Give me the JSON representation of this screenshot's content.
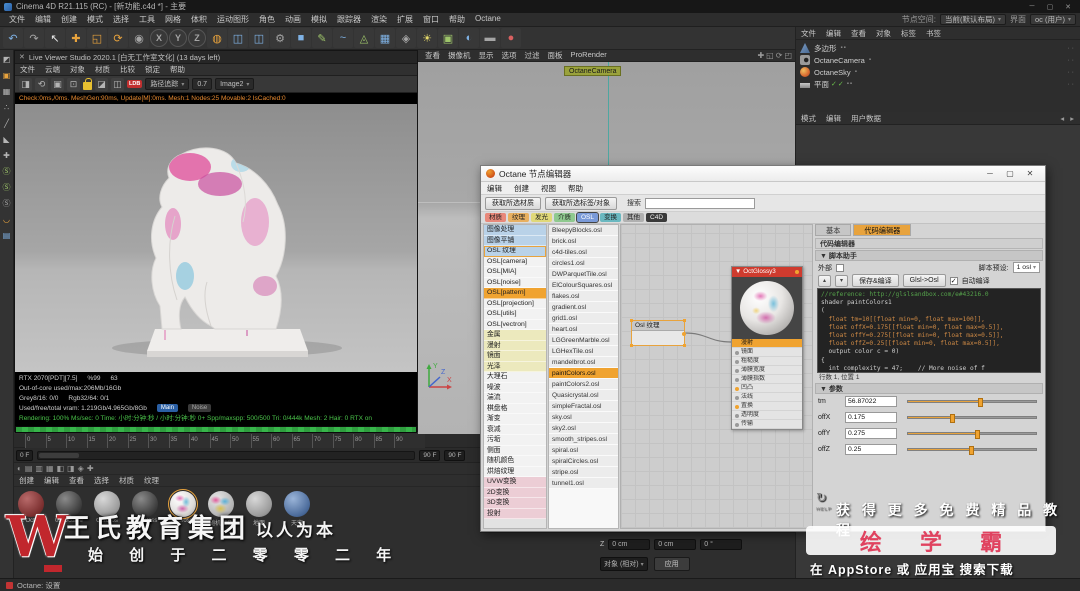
{
  "window": {
    "title": "Cinema 4D R21.115 (RC) - [新功能.c4d *] - 主要",
    "controls": {
      "min": "─",
      "max": "▢",
      "close": "✕"
    },
    "menus": [
      "文件",
      "编辑",
      "创建",
      "模式",
      "选择",
      "工具",
      "网格",
      "体积",
      "运动图形",
      "角色",
      "动画",
      "模拟",
      "跟踪器",
      "渲染",
      "扩展",
      "窗口",
      "帮助",
      "Octane"
    ],
    "node_space_label": "节点空间:",
    "node_space_value": "当前(默认布局)",
    "interface_label": "界面",
    "interface_value": "oc (用户)"
  },
  "toolbar": {
    "icons": [
      {
        "g": "↶",
        "cls": "c-blue",
        "name": "undo-icon"
      },
      {
        "g": "↷",
        "cls": "c-dim",
        "name": "redo-icon"
      },
      {
        "g": "↖",
        "cls": "c-white",
        "name": "selection-tool-icon"
      },
      {
        "g": "✚",
        "cls": "c-orange",
        "name": "move-tool-icon"
      },
      {
        "g": "◱",
        "cls": "c-orange",
        "name": "scale-tool-icon"
      },
      {
        "g": "⟳",
        "cls": "c-orange",
        "name": "rotate-tool-icon"
      },
      {
        "g": "◉",
        "cls": "c-dim",
        "name": "last-tool-icon"
      },
      {
        "g": "X",
        "cls": "c-dim tb-letter",
        "name": "x-axis-lock-icon"
      },
      {
        "g": "Y",
        "cls": "c-dim tb-letter",
        "name": "y-axis-lock-icon"
      },
      {
        "g": "Z",
        "cls": "c-dim tb-letter",
        "name": "z-axis-lock-icon"
      },
      {
        "g": "◍",
        "cls": "c-orange",
        "name": "coordinate-system-icon"
      },
      {
        "g": "◫",
        "cls": "c-blue",
        "name": "render-view-icon"
      },
      {
        "g": "◫",
        "cls": "c-blue",
        "name": "render-picture-viewer-icon"
      },
      {
        "g": "⚙",
        "cls": "c-dim",
        "name": "render-settings-icon"
      },
      {
        "g": "■",
        "cls": "c-blue",
        "name": "add-cube-icon"
      },
      {
        "g": "✎",
        "cls": "c-green",
        "name": "pen-tool-icon"
      },
      {
        "g": "~",
        "cls": "c-blue",
        "name": "spline-icon"
      },
      {
        "g": "◬",
        "cls": "c-green",
        "name": "mograph-icon"
      },
      {
        "g": "▦",
        "cls": "c-blue",
        "name": "volume-icon"
      },
      {
        "g": "◈",
        "cls": "c-dim",
        "name": "simulation-icon"
      },
      {
        "g": "☀",
        "cls": "c-yellow",
        "name": "light-icon"
      },
      {
        "g": "▣",
        "cls": "c-green",
        "name": "camera-icon"
      },
      {
        "g": "◐",
        "cls": "c-blue",
        "name": "environment-icon"
      },
      {
        "g": "▬",
        "cls": "c-dim",
        "name": "floor-icon"
      },
      {
        "g": "●",
        "cls": "c-red",
        "name": "material-ball-icon"
      }
    ]
  },
  "left_tools": [
    {
      "g": "◩",
      "cls": "c-gray",
      "name": "make-editable-icon"
    },
    {
      "g": "▣",
      "cls": "c-orange",
      "name": "model-mode-icon"
    },
    {
      "g": "▦",
      "cls": "c-gray",
      "name": "texture-mode-icon"
    },
    {
      "g": "∴",
      "cls": "c-gray",
      "name": "points-mode-icon"
    },
    {
      "g": "╱",
      "cls": "c-gray",
      "name": "edges-mode-icon"
    },
    {
      "g": "◣",
      "cls": "c-gray",
      "name": "polygons-mode-icon"
    },
    {
      "g": "✚",
      "cls": "c-gray",
      "name": "enable-axis-icon"
    },
    {
      "g": "Ⓢ",
      "cls": "c-green",
      "name": "viewport-solo-off-icon"
    },
    {
      "g": "Ⓢ",
      "cls": "c-green",
      "name": "viewport-solo-single-icon"
    },
    {
      "g": "Ⓢ",
      "cls": "c-dim",
      "name": "viewport-solo-hierarchy-icon"
    },
    {
      "g": "◡",
      "cls": "c-orange",
      "name": "snap-icon"
    },
    {
      "g": "▤",
      "cls": "c-blue",
      "name": "workplane-icon"
    }
  ],
  "live_viewer": {
    "close": "✕",
    "title": "Live Viewer Studio 2020.1 [白无工作室文化] (13 days left)",
    "menus": [
      "文件",
      "云端",
      "对象",
      "材质",
      "比较",
      "锁定",
      "帮助"
    ],
    "icons": [
      {
        "g": "◨",
        "name": "panel-toggle-icon"
      },
      {
        "g": "⟲",
        "name": "restart-render-icon"
      },
      {
        "g": "▣",
        "name": "focus-render-icon"
      },
      {
        "g": "⊡",
        "name": "region-render-icon"
      }
    ],
    "badge": "LDB",
    "kernel_value": "路径追踪",
    "exposure_value": "0.7",
    "image_value": "Image2",
    "info": "Check:0ms,/0ms. MeshGen:90ms, Update[M]:0ms. Mesh:1 Nodes:25 Movable:2 IsCached:0",
    "stats": {
      "gpu": "RTX 2070[PDT][7.5]",
      "pct": "%99",
      "val": "63",
      "line2": "Out-of-core used/max:206Mb/16Gb",
      "line3a": "Grey8/16:  0/0",
      "line3b": "Rgb32/64:  0/1",
      "line4": "Used/free/total vram: 1.219Gb/4.965Gb/8Gb",
      "main_btn": "Main",
      "noise_btn": "Noise",
      "line5": "Rendering: 100%  Ms/sec: 0  Time: 小时:分钟:秒 / 小时:分钟:秒 0+  Spp/maxspp: 500/500  Tri: 0/444k  Mesh: 2  Hair: 0  RTX on"
    }
  },
  "viewport": {
    "menus": [
      "查看",
      "摄像机",
      "显示",
      "选项",
      "过滤",
      "面板",
      "ProRender"
    ],
    "icons": [
      {
        "g": "✚",
        "name": "viewport-pan-icon"
      },
      {
        "g": "◱",
        "name": "viewport-zoom-icon"
      },
      {
        "g": "⟳",
        "name": "viewport-rotate-icon"
      },
      {
        "g": "◰",
        "name": "viewport-layout-icon"
      }
    ],
    "camera_label": "OctaneCamera",
    "axis": {
      "x": "X",
      "y": "Y",
      "z": "Z"
    }
  },
  "timeline": {
    "ticks": [
      "0",
      "5",
      "10",
      "15",
      "20",
      "25",
      "30",
      "35",
      "40",
      "45",
      "50",
      "55",
      "60",
      "65",
      "70",
      "75",
      "80",
      "85",
      "90"
    ],
    "current": "0 F",
    "end_a": "90 F",
    "end_b": "90 F"
  },
  "material_manager": {
    "icons": [
      {
        "g": "◐",
        "name": "material-panel-icon"
      },
      {
        "g": "▤",
        "name": "material-panel-icon"
      },
      {
        "g": "▥",
        "name": "material-panel-icon"
      },
      {
        "g": "▦",
        "name": "material-panel-icon"
      },
      {
        "g": "◧",
        "name": "material-panel-icon"
      },
      {
        "g": "◨",
        "name": "material-panel-icon"
      },
      {
        "g": "◈",
        "name": "material-panel-icon"
      },
      {
        "g": "✚",
        "name": "material-panel-icon"
      }
    ],
    "menus": [
      "创建",
      "编辑",
      "查看",
      "选择",
      "材质",
      "纹理"
    ],
    "materials": [
      {
        "label": "02 Octane",
        "cls": "m-red"
      },
      {
        "label": "02 Octane",
        "cls": "m-dark"
      },
      {
        "label": "OctGlos",
        "cls": "m-gray"
      },
      {
        "label": "OctGloss",
        "cls": "m-dark"
      },
      {
        "label": "OctGlossy3",
        "cls": "m-paint m-sel"
      },
      {
        "label": "随机颜色",
        "cls": "m-multi"
      },
      {
        "label": "地面",
        "cls": "m-gray"
      },
      {
        "label": "天空",
        "cls": "m-blue"
      }
    ]
  },
  "object_manager": {
    "menus": [
      "文件",
      "编辑",
      "查看",
      "对象",
      "标签",
      "书签"
    ],
    "items": [
      {
        "name": "多边形",
        "icon": "ic-poly",
        "checks": "",
        "tags": "▪▪",
        "dots": "··"
      },
      {
        "name": "OctaneCamera",
        "icon": "ic-cam",
        "checks": "",
        "tags": "▪",
        "dots": "··"
      },
      {
        "name": "OctaneSky",
        "icon": "ic-sky",
        "checks": "",
        "tags": "▪",
        "dots": "··"
      },
      {
        "name": "平面",
        "icon": "ic-plane",
        "checks": "✓✓",
        "tags": "▪▪",
        "dots": "··"
      }
    ]
  },
  "attribute_manager": {
    "menus": [
      "模式",
      "编辑",
      "用户数据"
    ],
    "nav": "◂ ▸"
  },
  "node_editor": {
    "title": "Octane 节点编辑器",
    "controls": {
      "min": "─",
      "max": "▢",
      "close": "✕"
    },
    "menus": [
      "编辑",
      "创建",
      "视图",
      "帮助"
    ],
    "get_material_btn": "获取所选材质",
    "get_tag_btn": "获取所选标签/对象",
    "search_label": "搜索",
    "search_value": "",
    "chips": [
      {
        "t": "材质",
        "cls": "ch-red"
      },
      {
        "t": "纹理",
        "cls": "ch-orange"
      },
      {
        "t": "发光",
        "cls": "ch-yellow"
      },
      {
        "t": "介质",
        "cls": "ch-green"
      },
      {
        "t": "OSL",
        "cls": "ch-blue ch-sel"
      },
      {
        "t": "变换",
        "cls": "ch-teal"
      },
      {
        "t": "其他",
        "cls": "ch-gray"
      },
      {
        "t": "C4D",
        "cls": "ch-dark"
      }
    ],
    "categories": [
      {
        "t": "图像处理",
        "cls": "r-blue"
      },
      {
        "t": "图像平铺",
        "cls": "r-blue"
      },
      {
        "t": "OSL 纹理",
        "cls": "r-blue r-outline"
      },
      {
        "t": "OSL[camera]",
        "cls": "r-white"
      },
      {
        "t": "OSL[MIA]",
        "cls": "r-white"
      },
      {
        "t": "OSL[noise]",
        "cls": "r-white"
      },
      {
        "t": "OSL[pattern]",
        "cls": "r-sel"
      },
      {
        "t": "OSL[projection]",
        "cls": "r-white"
      },
      {
        "t": "OSL[utils]",
        "cls": "r-white"
      },
      {
        "t": "OSL[vectron]",
        "cls": "r-white"
      },
      {
        "t": "金属",
        "cls": "r-yellow"
      },
      {
        "t": "漫射",
        "cls": "r-yellow"
      },
      {
        "t": "镜面",
        "cls": "r-yellow"
      },
      {
        "t": "光泽",
        "cls": "r-yellow"
      },
      {
        "t": "大理石",
        "cls": "r-white"
      },
      {
        "t": "噪波",
        "cls": "r-white"
      },
      {
        "t": "湍流",
        "cls": "r-white"
      },
      {
        "t": "棋盘格",
        "cls": "r-white"
      },
      {
        "t": "渐变",
        "cls": "r-white"
      },
      {
        "t": "衰减",
        "cls": "r-white"
      },
      {
        "t": "污垢",
        "cls": "r-white"
      },
      {
        "t": "侧面",
        "cls": "r-white"
      },
      {
        "t": "随机颜色",
        "cls": "r-white"
      },
      {
        "t": "烘焙纹理",
        "cls": "r-white"
      },
      {
        "t": "UVW变换",
        "cls": "r-pink"
      },
      {
        "t": "2D变换",
        "cls": "r-pink"
      },
      {
        "t": "3D变换",
        "cls": "r-pink"
      },
      {
        "t": "投射",
        "cls": "r-pink"
      }
    ],
    "files": [
      {
        "t": "BleepyBlocks.osl",
        "cls": ""
      },
      {
        "t": "brick.osl",
        "cls": ""
      },
      {
        "t": "c4d-tiles.osl",
        "cls": ""
      },
      {
        "t": "circles1.osl",
        "cls": ""
      },
      {
        "t": "DWParquetTile.osl",
        "cls": ""
      },
      {
        "t": "ElColourSquares.osl",
        "cls": ""
      },
      {
        "t": "flakes.osl",
        "cls": ""
      },
      {
        "t": "gradient.osl",
        "cls": ""
      },
      {
        "t": "grid1.osl",
        "cls": ""
      },
      {
        "t": "heart.osl",
        "cls": ""
      },
      {
        "t": "LGGreenMarble.osl",
        "cls": ""
      },
      {
        "t": "LGHexTile.osl",
        "cls": ""
      },
      {
        "t": "mandelbrot.osl",
        "cls": ""
      },
      {
        "t": "paintColors.osl",
        "cls": "f-sel"
      },
      {
        "t": "paintColors2.osl",
        "cls": ""
      },
      {
        "t": "Quasicrystal.osl",
        "cls": ""
      },
      {
        "t": "simpleFractal.osl",
        "cls": ""
      },
      {
        "t": "sky.osl",
        "cls": ""
      },
      {
        "t": "sky2.osl",
        "cls": ""
      },
      {
        "t": "smooth_stripes.osl",
        "cls": ""
      },
      {
        "t": "spiral.osl",
        "cls": ""
      },
      {
        "t": "spiralCircles.osl",
        "cls": ""
      },
      {
        "t": "stripe.osl",
        "cls": ""
      },
      {
        "t": "tunnel1.osl",
        "cls": ""
      }
    ],
    "graph": {
      "osl_node_title": "Osl 纹理",
      "glossy_node_title": "OctGlossy3",
      "glossy_inputs": [
        {
          "label": "漫射",
          "cls": "sel",
          "dot": "d-or"
        },
        {
          "label": "镜面",
          "cls": "",
          "dot": "d-gr"
        },
        {
          "label": "粗糙度",
          "cls": "",
          "dot": "d-gr"
        },
        {
          "label": "薄膜宽度",
          "cls": "",
          "dot": "d-gr"
        },
        {
          "label": "薄膜指数",
          "cls": "",
          "dot": "d-gr"
        },
        {
          "label": "凹凸",
          "cls": "",
          "dot": "d-or"
        },
        {
          "label": "法线",
          "cls": "",
          "dot": "d-gr"
        },
        {
          "label": "置换",
          "cls": "",
          "dot": "d-or"
        },
        {
          "label": "透明度",
          "cls": "",
          "dot": "d-gr"
        },
        {
          "label": "传输",
          "cls": "",
          "dot": "d-gr"
        }
      ]
    },
    "panel": {
      "tabs": [
        {
          "t": "基本",
          "cls": ""
        },
        {
          "t": "代码编辑器",
          "cls": "rt-sel"
        }
      ],
      "section": "代码编辑器",
      "helper_header": "▼ 脚本助手",
      "external_label": "外部",
      "preset_label": "脚本预设:",
      "preset_value": "1 osl",
      "compile_btn": "保存&编译",
      "glsl_btn": "Glsl->Osl",
      "auto_label": "自动编译",
      "auto_checked": "✓",
      "code": [
        {
          "t": "//reference: http://glslsandbox.com/e#43216.0",
          "cls": "c-com"
        },
        {
          "t": "shader paintColors1",
          "cls": "c-txt"
        },
        {
          "t": "(",
          "cls": "c-txt"
        },
        {
          "t": "  float tm=10[[float min=0, float max=100]],",
          "cls": "c-val"
        },
        {
          "t": "  float offX=0.175[[float min=0, float max=0.5]],",
          "cls": "c-val"
        },
        {
          "t": "  float offY=0.275[[float min=0, float max=0.5]],",
          "cls": "c-val"
        },
        {
          "t": "  float offZ=0.25[[float min=0, float max=0.5]],",
          "cls": "c-val"
        },
        {
          "t": "  output color c = 0)",
          "cls": "c-txt"
        },
        {
          "t": "{",
          "cls": "c-txt"
        },
        {
          "t": "  int complexity = 47;    // More noise of f",
          "cls": "c-txt"
        }
      ],
      "status": "行数 1, 位置 1",
      "params_header": "▼ 参数",
      "params": [
        {
          "name": "tm",
          "value": "56.87022",
          "pct": 57
        },
        {
          "name": "offX",
          "value": "0.175",
          "pct": 35
        },
        {
          "name": "offY",
          "value": "0.275",
          "pct": 55
        },
        {
          "name": "offZ",
          "value": "0.25",
          "pct": 50
        }
      ]
    }
  },
  "coordinate_manager": {
    "axis_label": "Z",
    "pos_value": "0 cm",
    "size_value": "0 cm",
    "rot_value": "0 °",
    "space_value": "对象 (相对)",
    "apply_btn": "应用"
  },
  "status_bar": {
    "text": "Octane: 设置"
  },
  "watermark": {
    "logo": "W",
    "company": "王氏教育集团",
    "slogan": "以人为本",
    "line2": "始 创 于 二 零 零 二 年"
  },
  "ad": {
    "help": "HELP",
    "line1": "获 得 更 多 免 费 精 品 教 程",
    "brand": "绘 学 霸",
    "line2": "在 AppStore 或 应用宝 搜索下载"
  }
}
